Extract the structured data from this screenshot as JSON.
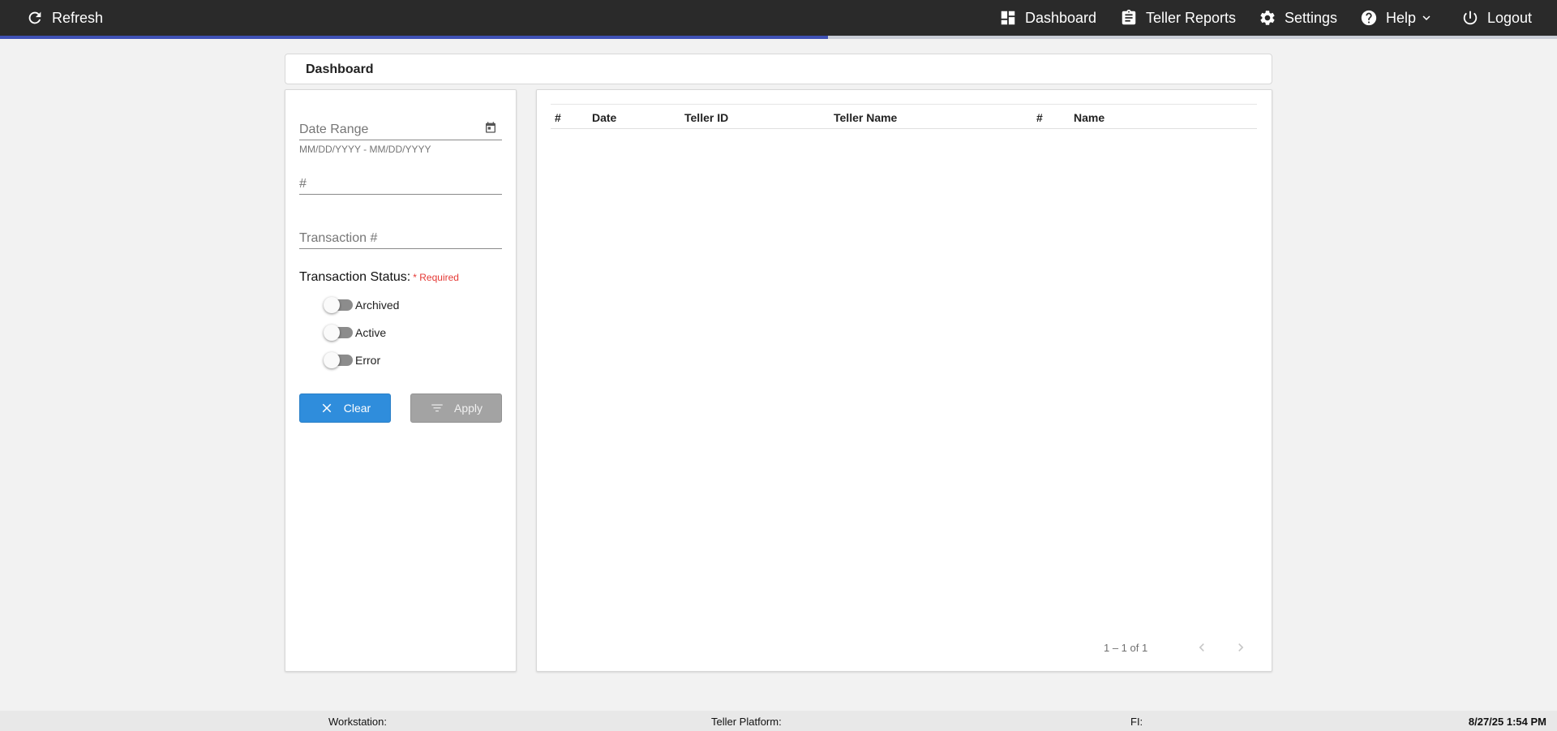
{
  "topbar": {
    "refresh_label": "Refresh",
    "refresh_icon": "refresh-icon",
    "nav": [
      {
        "label": "Dashboard",
        "icon": "dashboard-icon"
      },
      {
        "label": "Teller Reports",
        "icon": "clipboard-icon"
      },
      {
        "label": "Settings",
        "icon": "gear-icon"
      },
      {
        "label": "Help",
        "icon": "help-icon"
      },
      {
        "label": "Logout",
        "icon": "power-icon"
      }
    ],
    "progress_fraction": 0.532,
    "progress_color": "#3f51b5"
  },
  "breadcrumb": {
    "title": "Dashboard"
  },
  "filters": {
    "date_range": {
      "placeholder": "Date Range",
      "hint": "MM/DD/YYYY - MM/DD/YYYY"
    },
    "number": {
      "placeholder": "#"
    },
    "transaction": {
      "placeholder": "Transaction #"
    },
    "status_label": "Transaction Status:",
    "required_label": "* Required",
    "toggles": [
      {
        "label": "Archived",
        "checked": false
      },
      {
        "label": "Active",
        "checked": false
      },
      {
        "label": "Error",
        "checked": false
      }
    ],
    "clear_label": "Clear",
    "apply_label": "Apply"
  },
  "table": {
    "columns": [
      "#",
      "Date",
      "Teller ID",
      "Teller Name",
      "#",
      "Name"
    ],
    "rows": [],
    "pagination": {
      "range_text": "1 – 1 of 1"
    }
  },
  "footer": {
    "workstation_label": "Workstation:",
    "platform_label": "Teller Platform:",
    "fi_label": "FI:",
    "datetime": "8/27/25 1:54 PM"
  },
  "colors": {
    "topbar_bg": "#2a2a2a",
    "accent_blue": "#2f8ddc",
    "required_red": "#e53935",
    "apply_disabled": "#a3a3a3"
  }
}
